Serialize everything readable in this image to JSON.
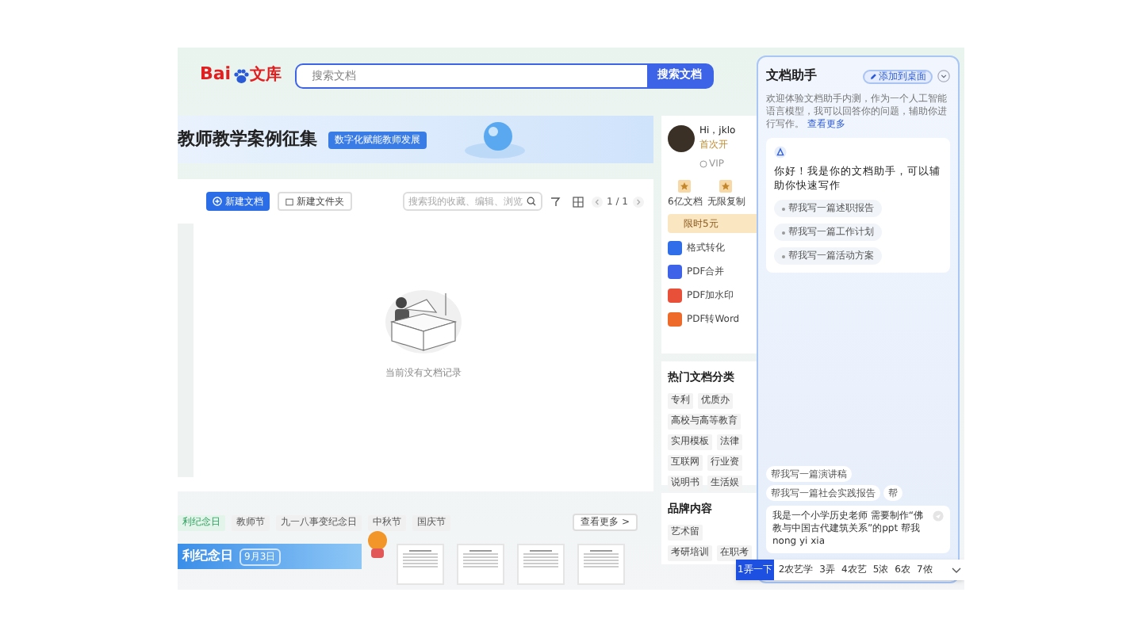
{
  "header": {
    "logo": {
      "latin": "Bai",
      "cjk": "文库"
    },
    "search": {
      "placeholder": "搜索文档",
      "button": "搜索文档"
    }
  },
  "banner": {
    "title": "教师教学案例征集",
    "badge": "数字化赋能教师发展"
  },
  "toolbar": {
    "new_doc": "新建文档",
    "new_folder": "新建文件夹",
    "search_placeholder": "搜索我的收藏、编辑、浏览",
    "page": "1 / 1"
  },
  "empty_state": "当前没有文档记录",
  "topic_tags": [
    {
      "label": "利纪念日",
      "selected": true
    },
    {
      "label": "教师节",
      "selected": false
    },
    {
      "label": "九一八事变纪念日",
      "selected": false
    },
    {
      "label": "中秋节",
      "selected": false
    },
    {
      "label": "国庆节",
      "selected": false
    }
  ],
  "see_more": "查看更多 >",
  "feature_card": {
    "title": "利纪念日",
    "date": "9月3日"
  },
  "profile": {
    "greeting": "Hi，jklo",
    "note": "首次开",
    "vip": "VIP",
    "perks": [
      "6亿文档",
      "无限复制"
    ],
    "offer": "限时5元"
  },
  "tools": [
    "格式转化",
    "PDF合并",
    "PDF加水印",
    "PDF转Word"
  ],
  "hot_categories": {
    "title": "热门文档分类",
    "tags": [
      [
        "专利",
        "优质办"
      ],
      [
        "高校与高等教育"
      ],
      [
        "实用模板",
        "法律"
      ],
      [
        "互联网",
        "行业资"
      ],
      [
        "说明书",
        "生活娱"
      ]
    ]
  },
  "brand": {
    "title": "品牌内容",
    "tags": [
      [
        "艺术留"
      ],
      [
        "考研培训",
        "在职考"
      ]
    ]
  },
  "assistant": {
    "title": "文档助手",
    "pin_button": "添加到桌面",
    "intro": "欢迎体验文档助手内测，作为一个人工智能语言模型，我可以回答你的问题，辅助你进行写作。",
    "more_link": "查看更多",
    "greeting": "你好！我是你的文档助手，可以辅助你快速写作",
    "prompts": [
      "帮我写一篇述职报告",
      "帮我写一篇工作计划",
      "帮我写一篇活动方案"
    ],
    "suggestions": [
      "帮我写一篇演讲稿",
      "帮我写一篇社会实践报告",
      "帮"
    ],
    "input": "我是一个小学历史老师 需要制作“佛教与中国古代建筑关系”的ppt 帮我nong yi xia"
  },
  "ime": {
    "candidates": [
      {
        "label": "1弄一下",
        "selected": true
      },
      {
        "label": "2农艺学",
        "selected": false
      },
      {
        "label": "3弄",
        "selected": false
      },
      {
        "label": "4农艺",
        "selected": false
      },
      {
        "label": "5浓",
        "selected": false
      },
      {
        "label": "6农",
        "selected": false
      },
      {
        "label": "7侬",
        "selected": false
      }
    ]
  }
}
